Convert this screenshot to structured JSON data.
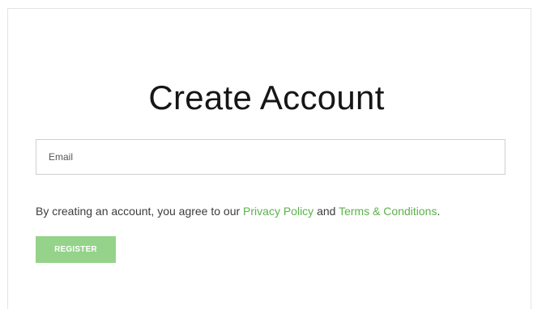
{
  "form": {
    "title": "Create Account",
    "email_placeholder": "Email",
    "agreement": {
      "prefix": "By creating an account, you agree to our ",
      "privacy_link": "Privacy Policy",
      "connector": " and ",
      "terms_link": "Terms & Conditions",
      "suffix": "."
    },
    "register_label": "REGISTER"
  },
  "colors": {
    "link": "#5bb24a",
    "button": "#95d38b",
    "border": "#cfcfcf"
  }
}
